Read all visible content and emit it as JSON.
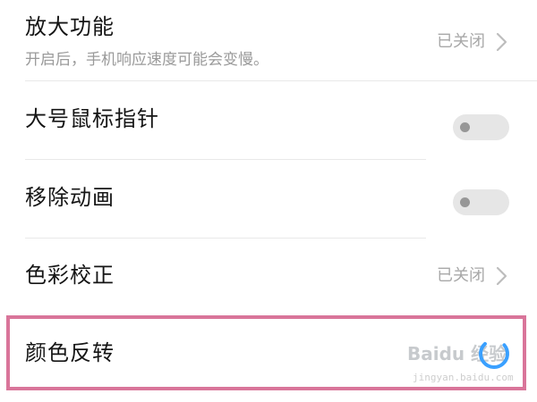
{
  "settings": {
    "items": [
      {
        "title": "放大功能",
        "subtitle": "开启后，手机响应速度可能会变慢。",
        "status": "已关闭",
        "control": "chevron"
      },
      {
        "title": "大号鼠标指针",
        "control": "toggle",
        "enabled": false
      },
      {
        "title": "移除动画",
        "control": "toggle",
        "enabled": false
      },
      {
        "title": "色彩校正",
        "status": "已关闭",
        "control": "chevron"
      },
      {
        "title": "颜色反转",
        "control": "spinner",
        "highlighted": true
      }
    ]
  },
  "watermark": {
    "main": "Baidu 经验",
    "sub": "jingyan.baidu.com"
  },
  "colors": {
    "background": "#ffffff",
    "title_text": "#151515",
    "secondary_text": "#9a9a9a",
    "status_text": "#a8a8a8",
    "toggle_track_off": "#e6e6e6",
    "toggle_knob_off": "#979797",
    "highlight_border": "#d9759a",
    "spinner_blue": "#3aa0ff"
  }
}
